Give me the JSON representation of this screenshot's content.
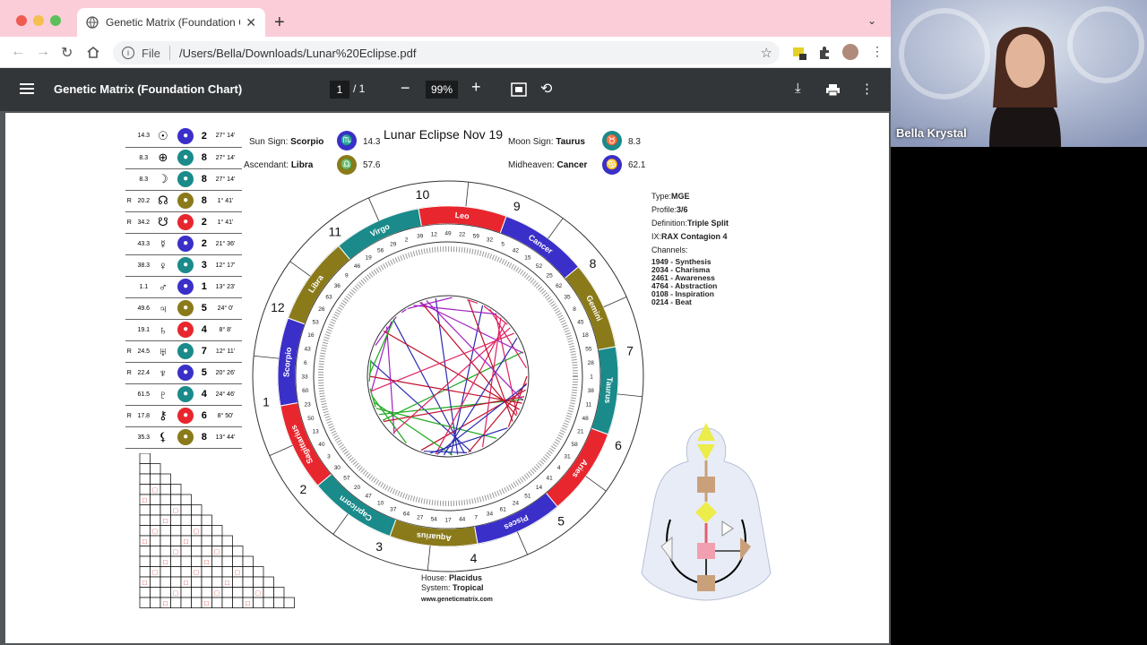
{
  "browser": {
    "tab_title": "Genetic Matrix (Foundation Ch",
    "url_scheme": "File",
    "url_path": "/Users/Bella/Downloads/Lunar%20Eclipse.pdf",
    "new_tab_symbol": "+",
    "tab_close_symbol": "✕"
  },
  "pdf_viewer": {
    "title": "Genetic Matrix (Foundation Chart)",
    "page_current": "1",
    "page_total": "/ 1",
    "zoom": "99%"
  },
  "chart": {
    "title": "Lunar Eclipse Nov 19",
    "sun_sign_label": "Sun Sign:",
    "sun_sign": "Scorpio",
    "sun_value": "14.3",
    "moon_sign_label": "Moon Sign:",
    "moon_sign": "Taurus",
    "moon_value": "8.3",
    "ascendant_label": "Ascendant:",
    "ascendant": "Libra",
    "ascendant_value": "57.6",
    "midheaven_label": "Midheaven:",
    "midheaven": "Cancer",
    "midheaven_value": "62.1",
    "house_label": "House:",
    "house": "Placidus",
    "system_label": "System:",
    "system": "Tropical",
    "website": "www.geneticmatrix.com",
    "house_numbers": [
      "10",
      "9",
      "8",
      "7",
      "6",
      "5",
      "4",
      "3",
      "2",
      "1",
      "12",
      "11"
    ],
    "signs": [
      "Cancer",
      "Gemini",
      "Taurus",
      "Aries",
      "Pisces",
      "Aquarius",
      "Capricorn",
      "Sagittarius",
      "Scorpio",
      "Libra",
      "Virgo",
      "Leo"
    ]
  },
  "planets": [
    {
      "r": "",
      "val": "14.3",
      "glyph": "☉",
      "num": "2",
      "deg": "27° 14'"
    },
    {
      "r": "",
      "val": "8.3",
      "glyph": "⊕",
      "num": "8",
      "deg": "27° 14'"
    },
    {
      "r": "",
      "val": "8.3",
      "glyph": "☽",
      "num": "8",
      "deg": "27° 14'"
    },
    {
      "r": "R",
      "val": "20.2",
      "glyph": "☊",
      "num": "8",
      "deg": "1° 41'"
    },
    {
      "r": "R",
      "val": "34.2",
      "glyph": "☋",
      "num": "2",
      "deg": "1° 41'"
    },
    {
      "r": "",
      "val": "43.3",
      "glyph": "☿",
      "num": "2",
      "deg": "21° 36'"
    },
    {
      "r": "",
      "val": "38.3",
      "glyph": "♀",
      "num": "3",
      "deg": "12° 17'"
    },
    {
      "r": "",
      "val": "1.1",
      "glyph": "♂",
      "num": "1",
      "deg": "13° 23'"
    },
    {
      "r": "",
      "val": "49.6",
      "glyph": "♃",
      "num": "5",
      "deg": "24° 0'"
    },
    {
      "r": "",
      "val": "19.1",
      "glyph": "♄",
      "num": "4",
      "deg": "8° 8'"
    },
    {
      "r": "R",
      "val": "24.5",
      "glyph": "♅",
      "num": "7",
      "deg": "12° 11'"
    },
    {
      "r": "R",
      "val": "22.4",
      "glyph": "♆",
      "num": "5",
      "deg": "20° 26'"
    },
    {
      "r": "",
      "val": "61.5",
      "glyph": "♇",
      "num": "4",
      "deg": "24° 46'"
    },
    {
      "r": "R",
      "val": "17.8",
      "glyph": "⚷",
      "num": "6",
      "deg": "8° 50'"
    },
    {
      "r": "",
      "val": "35.3",
      "glyph": "⚸",
      "num": "8",
      "deg": "13° 44'"
    }
  ],
  "human_design": {
    "type_label": "Type:",
    "type": "MGE",
    "profile_label": "Profile:",
    "profile": "3/6",
    "definition_label": "Definition:",
    "definition": "Triple Split",
    "ix_label": "IX:",
    "ix": "RAX Contagion 4",
    "channels_label": "Channels:",
    "channels": [
      "1949 - Synthesis",
      "2034 - Charisma",
      "2461 - Awareness",
      "4764 - Abstraction",
      "0108 - Inspiration",
      "0214 - Beat"
    ]
  },
  "webcam": {
    "name": "Bella Krystal"
  },
  "colors": {
    "tabbar": "#fbcdd8",
    "pdf_toolbar": "#323639",
    "sign_fire": "#e8262e",
    "sign_water": "#2e3fc7",
    "sign_air": "#1a8a8a",
    "sign_earth": "#8a7a1a"
  }
}
